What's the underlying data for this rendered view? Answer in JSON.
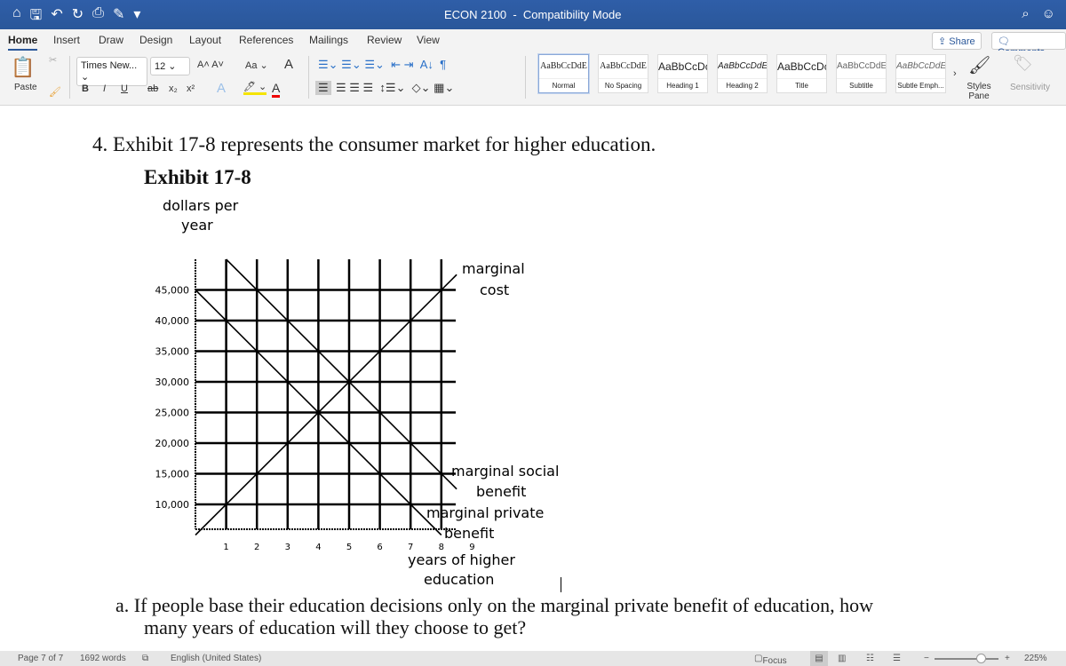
{
  "window": {
    "title": "ECON 2100",
    "mode": "Compatibility Mode"
  },
  "tabs": [
    "Home",
    "Insert",
    "Draw",
    "Design",
    "Layout",
    "References",
    "Mailings",
    "Review",
    "View"
  ],
  "top_buttons": {
    "share": "Share",
    "comments": "Comments"
  },
  "ribbon": {
    "paste": "Paste",
    "font": "Times New...",
    "size": "12",
    "change_case": "Aa",
    "bold": "B",
    "italic": "I",
    "underline": "U",
    "strike": "ab",
    "sub": "x₂",
    "sup": "x²",
    "styles_pane": "Styles Pane",
    "sensitivity": "Sensitivity",
    "styles": [
      {
        "preview": "AaBbCcDdE",
        "name": "Normal"
      },
      {
        "preview": "AaBbCcDdE",
        "name": "No Spacing"
      },
      {
        "preview": "AaBbCcDc",
        "name": "Heading 1"
      },
      {
        "preview": "AaBbCcDdE",
        "name": "Heading 2"
      },
      {
        "preview": "AaBbCcDc",
        "name": "Title"
      },
      {
        "preview": "AaBbCcDdEe",
        "name": "Subtitle"
      },
      {
        "preview": "AaBbCcDdEe",
        "name": "Subtle Emph..."
      }
    ]
  },
  "document": {
    "question": "4. Exhibit 17-8 represents the consumer market for higher education.",
    "exhibit_title": "Exhibit 17-8",
    "part_a_1": "a.  If people base their education decisions only on the marginal private benefit of education, how",
    "part_a_2": "many years of education will they choose to get?"
  },
  "chart_data": {
    "type": "line",
    "ylabel": [
      "dollars per",
      "year"
    ],
    "xlabel": [
      "years of higher",
      "education"
    ],
    "x_ticks": [
      1,
      2,
      3,
      4,
      5,
      6,
      7,
      8,
      9
    ],
    "y_ticks": [
      "10,000",
      "15,000",
      "20,000",
      "25,000",
      "30,000",
      "35,000",
      "40,000",
      "45,000"
    ],
    "y_tick_values": [
      10000,
      15000,
      20000,
      25000,
      30000,
      35000,
      40000,
      45000
    ],
    "xlim": [
      0,
      9
    ],
    "ylim": [
      5000,
      50000
    ],
    "grid": true,
    "series": [
      {
        "name": "marginal cost",
        "label": [
          "marginal",
          "cost"
        ],
        "x": [
          0,
          8.5
        ],
        "y": [
          5000,
          47500
        ]
      },
      {
        "name": "marginal social benefit",
        "label": [
          "marginal social",
          "benefit"
        ],
        "x": [
          1,
          8.5
        ],
        "y": [
          50000,
          12500
        ]
      },
      {
        "name": "marginal private benefit",
        "label": [
          "marginal private",
          "benefit"
        ],
        "x": [
          0,
          8
        ],
        "y": [
          45000,
          5000
        ]
      }
    ]
  },
  "status": {
    "page": "Page 7 of 7",
    "words": "1692 words",
    "language": "English (United States)",
    "focus": "Focus",
    "zoom": "225%",
    "zoom_level": 0.72
  }
}
